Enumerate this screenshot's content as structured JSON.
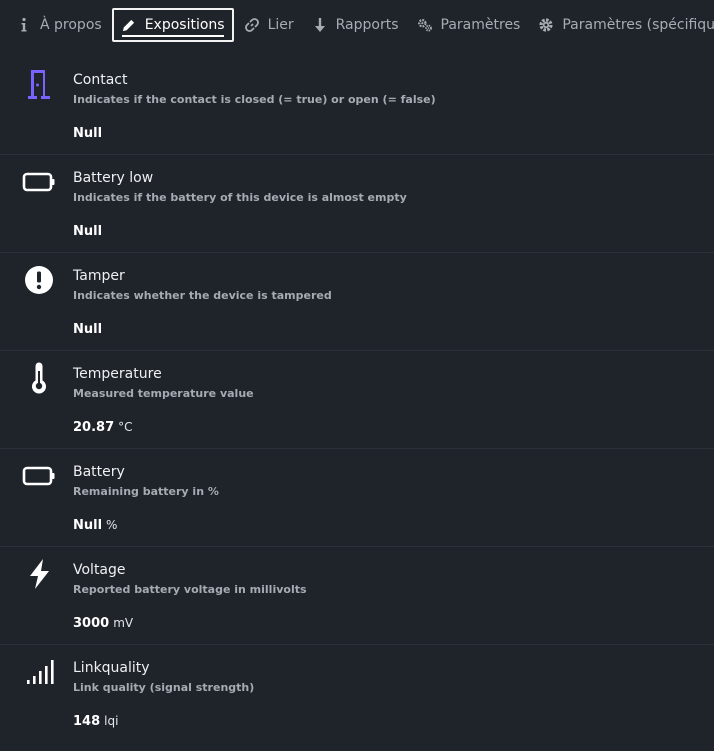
{
  "tabs": [
    {
      "label": "À propos",
      "icon": "info-icon"
    },
    {
      "label": "Expositions",
      "icon": "pencil-icon",
      "active": true
    },
    {
      "label": "Lier",
      "icon": "link-icon"
    },
    {
      "label": "Rapports",
      "icon": "arrow-down-icon"
    },
    {
      "label": "Paramètres",
      "icon": "gears-icon"
    },
    {
      "label": "Paramètres (spécifiques)",
      "icon": "gear-icon"
    }
  ],
  "exposes": [
    {
      "name": "Contact",
      "description": "Indicates if the contact is closed (= true) or open (= false)",
      "value": "Null",
      "unit": "",
      "icon": "door-icon",
      "icon_color": "#7b61ff"
    },
    {
      "name": "Battery low",
      "description": "Indicates if the battery of this device is almost empty",
      "value": "Null",
      "unit": "",
      "icon": "battery-empty-icon"
    },
    {
      "name": "Tamper",
      "description": "Indicates whether the device is tampered",
      "value": "Null",
      "unit": "",
      "icon": "exclamation-circle-icon"
    },
    {
      "name": "Temperature",
      "description": "Measured temperature value",
      "value": "20.87",
      "unit": "°C",
      "icon": "thermometer-icon"
    },
    {
      "name": "Battery",
      "description": "Remaining battery in %",
      "value": "Null",
      "unit": "%",
      "icon": "battery-icon"
    },
    {
      "name": "Voltage",
      "description": "Reported battery voltage in millivolts",
      "value": "3000",
      "unit": "mV",
      "icon": "bolt-icon"
    },
    {
      "name": "Linkquality",
      "description": "Link quality (signal strength)",
      "value": "148",
      "unit": "lqi",
      "icon": "signal-icon"
    }
  ]
}
